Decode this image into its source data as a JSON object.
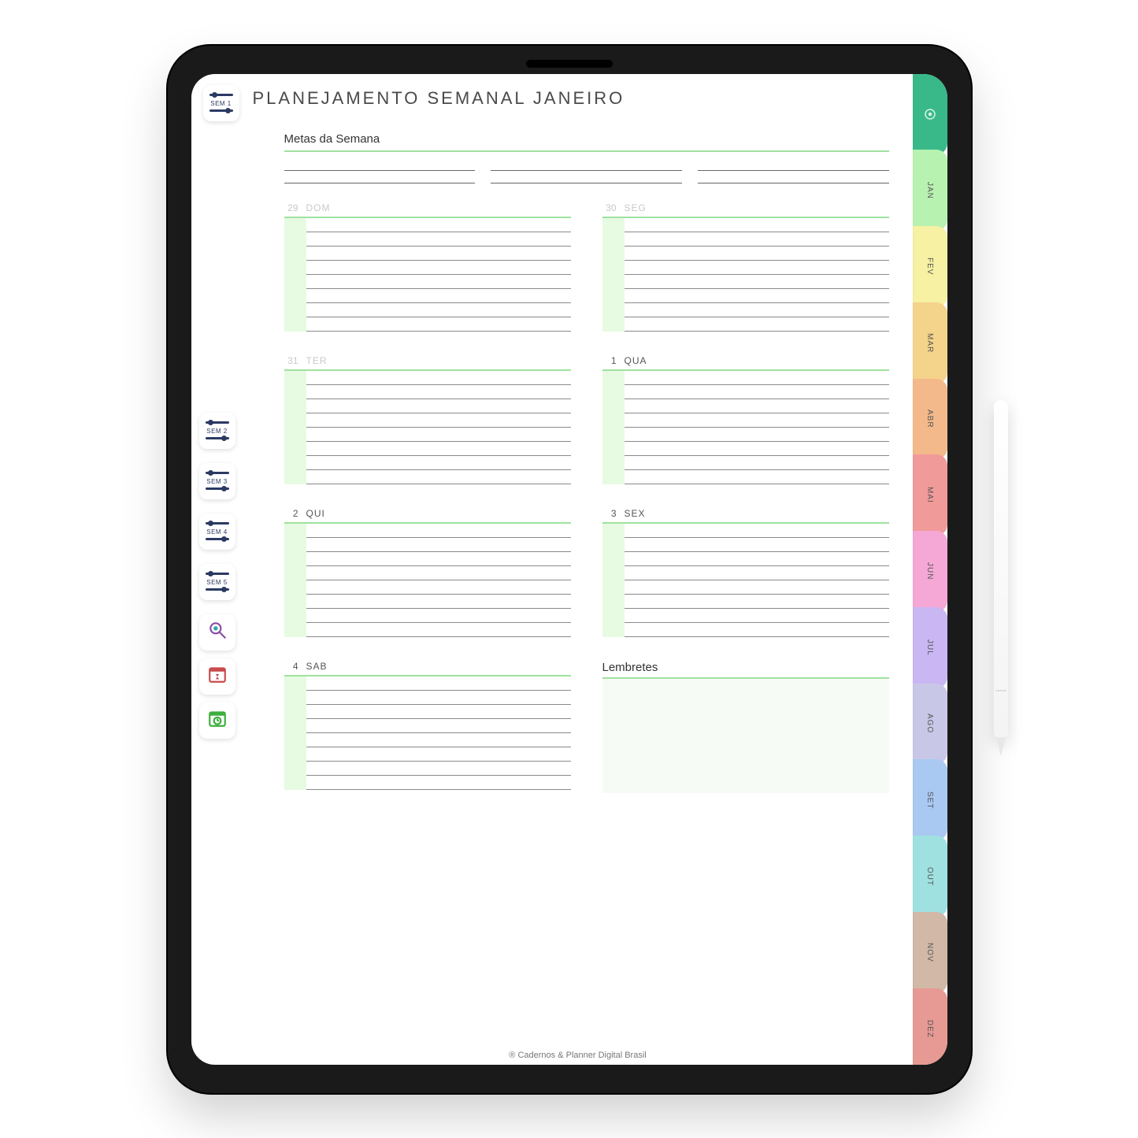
{
  "header": {
    "title": "PLANEJAMENTO SEMANAL JANEIRO",
    "current_week_badge": "SEM 1"
  },
  "metas": {
    "label": "Metas da Semana"
  },
  "days": [
    {
      "num": "29",
      "dow": "DOM",
      "muted": true
    },
    {
      "num": "30",
      "dow": "SEG",
      "muted": true
    },
    {
      "num": "31",
      "dow": "TER",
      "muted": true
    },
    {
      "num": "1",
      "dow": "QUA",
      "muted": false
    },
    {
      "num": "2",
      "dow": "QUI",
      "muted": false
    },
    {
      "num": "3",
      "dow": "SEX",
      "muted": false
    },
    {
      "num": "4",
      "dow": "SAB",
      "muted": false
    }
  ],
  "reminders": {
    "label": "Lembretes"
  },
  "left_rail": {
    "weeks": [
      "SEM 2",
      "SEM 3",
      "SEM 4",
      "SEM 5"
    ]
  },
  "month_tabs": [
    {
      "label": "",
      "color": "#39b98a",
      "is_home": true
    },
    {
      "label": "JAN",
      "color": "#b8f2b1"
    },
    {
      "label": "FEV",
      "color": "#f6f1a3"
    },
    {
      "label": "MAR",
      "color": "#f4d38a"
    },
    {
      "label": "ABR",
      "color": "#f4b98a"
    },
    {
      "label": "MAI",
      "color": "#f19a9a"
    },
    {
      "label": "JUN",
      "color": "#f5a8d6"
    },
    {
      "label": "JUL",
      "color": "#c9b6f2"
    },
    {
      "label": "AGO",
      "color": "#c9c7e8"
    },
    {
      "label": "SET",
      "color": "#a9c8f2"
    },
    {
      "label": "OUT",
      "color": "#9fe0e0"
    },
    {
      "label": "NOV",
      "color": "#d1b8a7"
    },
    {
      "label": "DEZ",
      "color": "#e69a93"
    }
  ],
  "footer": {
    "credit": "® Cadernos & Planner Digital Brasil"
  },
  "layout": {
    "day_line_count": 8,
    "metas_line_count": 2
  }
}
